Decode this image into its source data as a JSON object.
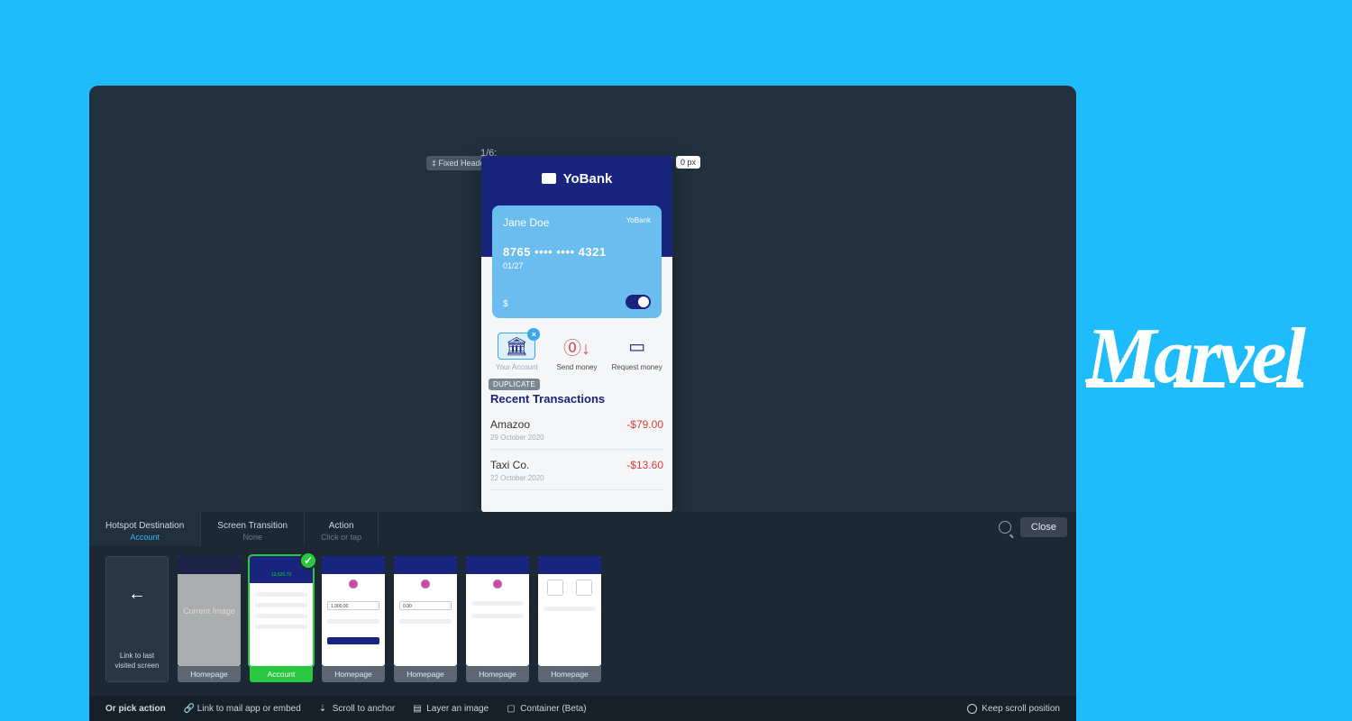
{
  "brand": {
    "name": "Marvel"
  },
  "editor": {
    "pager": "1/6:",
    "fixed_badge": "‡ Fixed Header",
    "px_bubble": "0 px",
    "phone": {
      "app_name": "YoBank",
      "card": {
        "holder": "Jane Doe",
        "brand": "YoBank",
        "number": "8765 •••• •••• 4321",
        "expiry": "01/27",
        "currency": "$"
      },
      "actions": [
        {
          "name": "account",
          "label": "Your Account",
          "glyph": "🏛",
          "selected": true
        },
        {
          "name": "send",
          "label": "Send money",
          "glyph": "⓪↓",
          "selected": false
        },
        {
          "name": "request",
          "label": "Request money",
          "glyph": "▭",
          "selected": false
        }
      ],
      "duplicate_badge": "DUPLICATE",
      "recent_title": "Recent Transactions",
      "transactions": [
        {
          "merchant": "Amazoo",
          "date": "29 October 2020",
          "amount": "-$79.00"
        },
        {
          "merchant": "Taxi Co.",
          "date": "22 October 2020",
          "amount": "-$13.60"
        }
      ]
    },
    "strip": {
      "tabs": [
        {
          "title": "Hotspot Destination",
          "value": "Account",
          "active": true
        },
        {
          "title": "Screen Transition",
          "value": "None",
          "active": false
        },
        {
          "title": "Action",
          "value": "Click or tap",
          "active": false
        }
      ],
      "close_label": "Close",
      "thumbnails": {
        "link_back": {
          "arrow": "←",
          "text_line1": "Link to last",
          "text_line2": "visited screen"
        },
        "items": [
          {
            "caption": "Homepage",
            "current": true,
            "selected": false,
            "overlay": "Current Image"
          },
          {
            "caption": "Account",
            "current": false,
            "selected": true
          },
          {
            "caption": "Homepage",
            "current": false,
            "selected": false,
            "amount": "1,000.00"
          },
          {
            "caption": "Homepage",
            "current": false,
            "selected": false,
            "amount": "0.00"
          },
          {
            "caption": "Homepage",
            "current": false,
            "selected": false
          },
          {
            "caption": "Homepage",
            "current": false,
            "selected": false
          }
        ],
        "mini_balance": "12,520.70"
      }
    },
    "footer": {
      "lead": "Or pick action",
      "items": [
        "Link to mail app or embed",
        "Scroll to anchor",
        "Layer an image",
        "Container (Beta)"
      ],
      "keep_scroll": "Keep scroll position"
    }
  }
}
